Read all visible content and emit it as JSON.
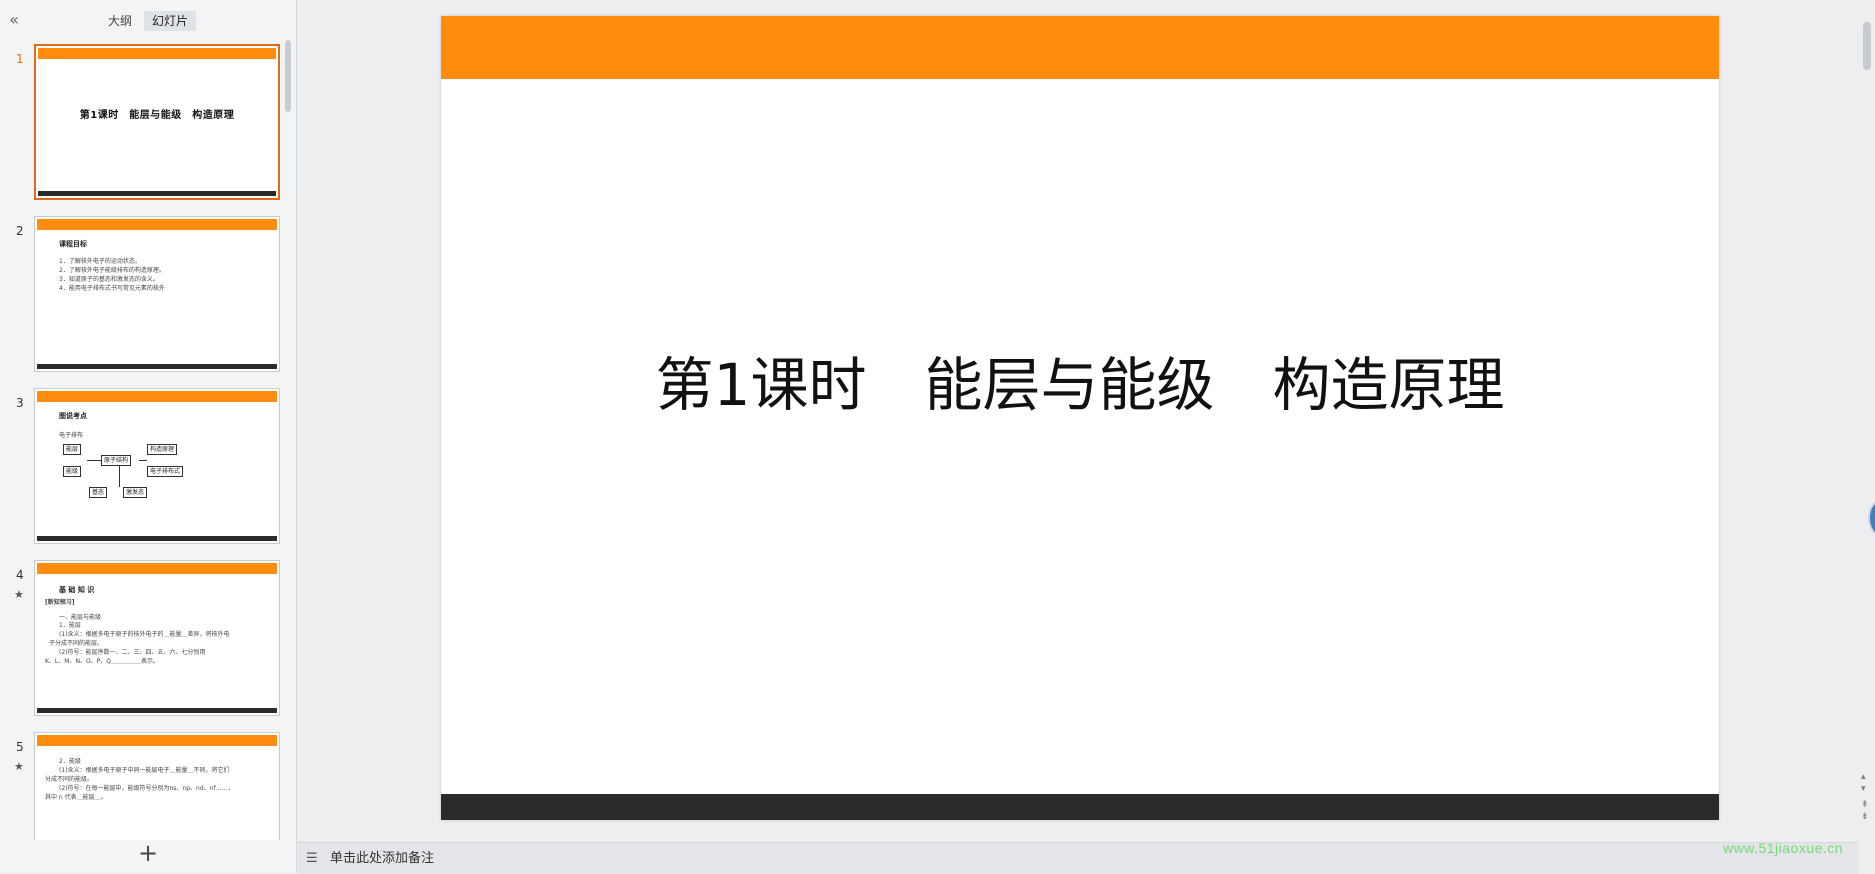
{
  "header": {
    "collapse_icon": "«",
    "tabs": [
      {
        "label": "大纲",
        "active": false
      },
      {
        "label": "幻灯片",
        "active": true
      }
    ]
  },
  "thumbnails": [
    {
      "number": "1",
      "selected": true,
      "title": "第1课时　能层与能级　构造原理"
    },
    {
      "number": "2",
      "heading": "课程目标",
      "lines": [
        "1．了解核外电子的运动状态。",
        "2．了解核外电子能级排布的构造原理。",
        "3．知道原子的基态和激发态的含义。",
        "4．能用电子排布式书写常见元素的核外"
      ]
    },
    {
      "number": "3",
      "heading": "图说考点",
      "caption": "电子排布",
      "diagram": {
        "left": [
          "能层",
          "能级"
        ],
        "center": "原子结构",
        "right": [
          "构造原理",
          "电子排布式"
        ],
        "bottom": [
          "基态",
          "激发态"
        ]
      }
    },
    {
      "number": "4",
      "star": "★",
      "heading": "基 础 知 识",
      "subheading": "[新知预习]",
      "lines": [
        "一、能层与能级",
        "1．能层",
        "(1)含义：根据多电子原子的核外电子的＿能量＿差异，将核外电",
        "子分成不同的能层。",
        "(2)符号：能层序数一、二、三、四、五、六、七分别用",
        "K、L、M、N、O、P、Q＿＿＿＿＿表示。"
      ]
    },
    {
      "number": "5",
      "star": "★",
      "lines": [
        "2．能级",
        "(1)含义：根据多电子原子中同一能层电子＿能量＿不同，将它们",
        "分成不同的能级。",
        "(2)符号：在每一能层中，能级符号分别为ns、np、nd、nf……，",
        "其中 n 代表＿能层＿。"
      ]
    }
  ],
  "main_slide": {
    "title": "第1课时　能层与能级　构造原理"
  },
  "notes": {
    "placeholder": "单击此处添加备注"
  },
  "add_slide_icon": "+",
  "watermark": "www.51jiaoxue.cn",
  "colors": {
    "accent_orange": "#ff8c0f",
    "footer_dark": "#2b2b2b",
    "selection_border": "#e06a1a"
  }
}
